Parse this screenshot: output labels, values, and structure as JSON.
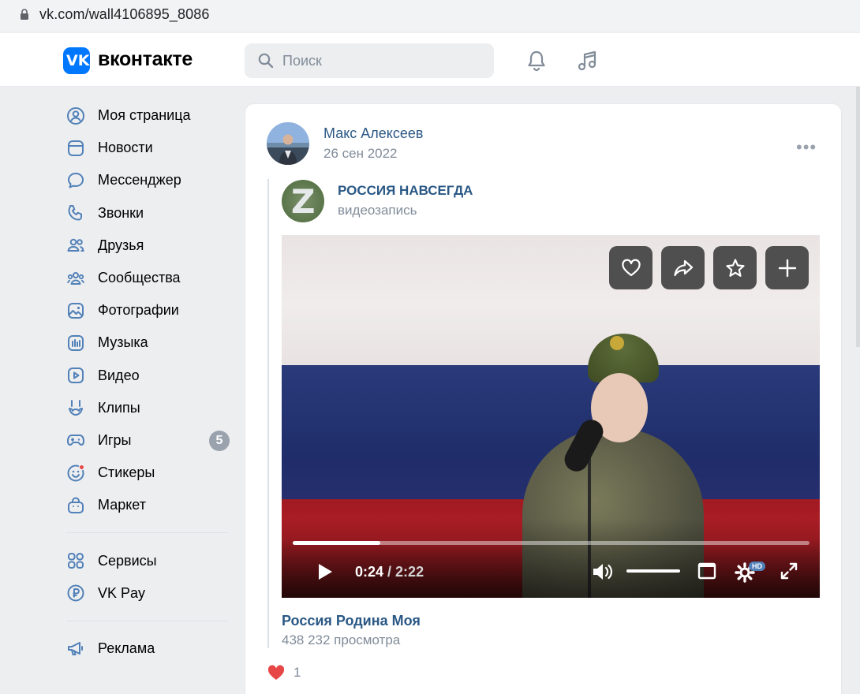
{
  "browser": {
    "url": "vk.com/wall4106895_8086"
  },
  "header": {
    "logo_glyph": "VK",
    "logo_text": "вконтакте",
    "search_placeholder": "Поиск",
    "icons": [
      "bell-icon",
      "music-note-icon"
    ]
  },
  "nav": {
    "items": [
      {
        "label": "Моя страница",
        "icon": "user-circle-icon"
      },
      {
        "label": "Новости",
        "icon": "newsfeed-icon"
      },
      {
        "label": "Мессенджер",
        "icon": "message-icon"
      },
      {
        "label": "Звонки",
        "icon": "phone-icon"
      },
      {
        "label": "Друзья",
        "icon": "friends-icon"
      },
      {
        "label": "Сообщества",
        "icon": "communities-icon"
      },
      {
        "label": "Фотографии",
        "icon": "photo-icon"
      },
      {
        "label": "Музыка",
        "icon": "music-icon"
      },
      {
        "label": "Видео",
        "icon": "video-icon"
      },
      {
        "label": "Клипы",
        "icon": "clips-icon"
      },
      {
        "label": "Игры",
        "icon": "gamepad-icon",
        "badge": "5"
      },
      {
        "label": "Стикеры",
        "icon": "smile-icon"
      },
      {
        "label": "Маркет",
        "icon": "bag-icon"
      }
    ],
    "items2": [
      {
        "label": "Сервисы",
        "icon": "services-icon"
      },
      {
        "label": "VK Pay",
        "icon": "ruble-icon"
      }
    ],
    "items3": [
      {
        "label": "Реклама",
        "icon": "megaphone-icon"
      }
    ]
  },
  "post": {
    "author": "Макс Алексеев",
    "date": "26 сен 2022",
    "more_glyph": "•••",
    "repost": {
      "avatar_letter": "Z",
      "source_name": "РОССИЯ НАВСЕГДА",
      "source_type": "видеозапись"
    },
    "video": {
      "current_time": "0:24",
      "duration": "/ 2:22",
      "progress_fraction": 0.169,
      "hd_label": "HD",
      "title": "Россия Родина Моя",
      "views": "438 232 просмотра",
      "overlay_buttons": [
        "heart-icon",
        "share-icon",
        "star-icon",
        "plus-icon"
      ],
      "colors": {
        "flag_blue": "#1f2d6a",
        "flag_red": "#b01e26",
        "progress": "#ffffff"
      }
    },
    "likes": {
      "count": "1",
      "color": "#e64646"
    }
  },
  "colors": {
    "accent": "#0077ff",
    "link": "#2a5885",
    "secondary": "#818c99",
    "background": "#edeef0"
  }
}
